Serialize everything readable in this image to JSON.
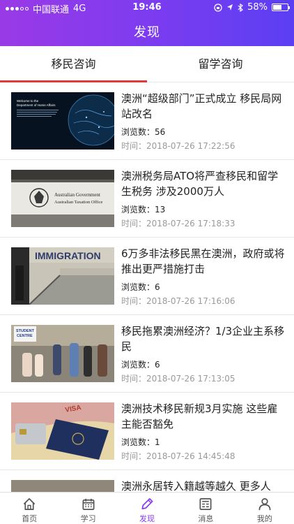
{
  "status_bar": {
    "carrier": "中国联通",
    "network": "4G",
    "time": "19:46",
    "battery": "58%",
    "battery_level": 0.58
  },
  "header": {
    "title": "发现"
  },
  "tabs": [
    {
      "label": "移民咨询",
      "active": true
    },
    {
      "label": "留学咨询",
      "active": false
    }
  ],
  "labels": {
    "views": "浏览数：",
    "time": "时间："
  },
  "articles": [
    {
      "title": "澳洲“超级部门”正式成立 移民局网站改名",
      "views": "56",
      "time": "2018-07-26 17:22:56",
      "image": "home-affairs-globe",
      "image_text": [
        "Welcome to the",
        "Department of Home Affairs"
      ]
    },
    {
      "title": "澳洲税务局ATO将严查移民和留学生税务 涉及2000万人",
      "views": "13",
      "time": "2018-07-26 17:18:33",
      "image": "ato-sign",
      "image_text": [
        "Australian Government",
        "Australian Taxation Office"
      ]
    },
    {
      "title": "6万多非法移民黑在澳洲，政府或将推出更严措施打击",
      "views": "6",
      "time": "2018-07-26 17:16:06",
      "image": "immigration-sign",
      "image_text": [
        "IMMIGRATION"
      ]
    },
    {
      "title": "移民拖累澳洲经济？1/3企业主系移民",
      "views": "6",
      "time": "2018-07-26 17:13:05",
      "image": "street-crowd",
      "image_text": [
        "STUDENT",
        "CENTRE"
      ]
    },
    {
      "title": "澳洲技术移民新规3月实施 这些雇主能否豁免",
      "views": "1",
      "time": "2018-07-26 14:45:48",
      "image": "passport-visa",
      "image_text": [
        "VISA"
      ]
    },
    {
      "title": "澳洲永居转入籍越等越久 更多人",
      "views": "",
      "time": "",
      "image": "partial"
    }
  ],
  "bottom_nav": [
    {
      "label": "首页",
      "icon": "home-icon",
      "active": false
    },
    {
      "label": "学习",
      "icon": "calendar-icon",
      "active": false
    },
    {
      "label": "发现",
      "icon": "pencil-icon",
      "active": true
    },
    {
      "label": "消息",
      "icon": "news-icon",
      "active": false
    },
    {
      "label": "我的",
      "icon": "person-icon",
      "active": false
    }
  ],
  "colors": {
    "header_start": "#9a3ae6",
    "header_end": "#5b3ff3",
    "tab_indicator": "#e53935",
    "active_nav": "#8a3cf0"
  }
}
